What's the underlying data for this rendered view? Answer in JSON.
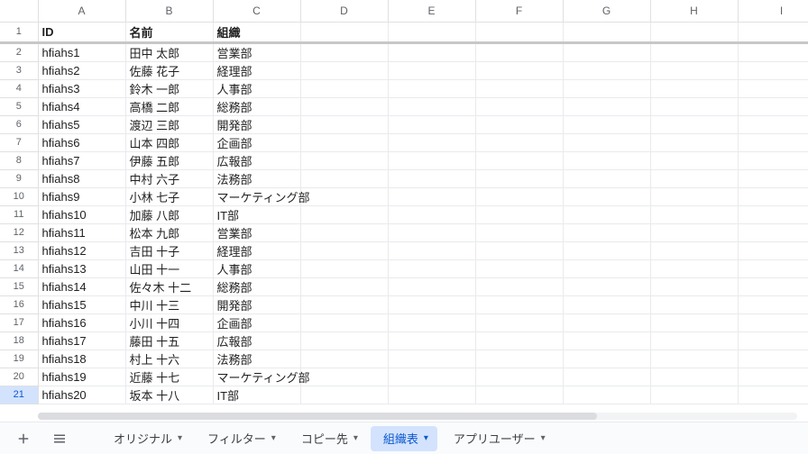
{
  "columns": [
    "A",
    "B",
    "C",
    "D",
    "E",
    "F",
    "G",
    "H",
    "I"
  ],
  "header_row": {
    "A": "ID",
    "B": "名前",
    "C": "組織"
  },
  "active_row": 21,
  "rows": [
    {
      "n": 2,
      "A": "hfiahs1",
      "B": "田中 太郎",
      "C": "営業部"
    },
    {
      "n": 3,
      "A": "hfiahs2",
      "B": "佐藤 花子",
      "C": "経理部"
    },
    {
      "n": 4,
      "A": "hfiahs3",
      "B": "鈴木 一郎",
      "C": "人事部"
    },
    {
      "n": 5,
      "A": "hfiahs4",
      "B": "高橋 二郎",
      "C": "総務部"
    },
    {
      "n": 6,
      "A": "hfiahs5",
      "B": "渡辺 三郎",
      "C": "開発部"
    },
    {
      "n": 7,
      "A": "hfiahs6",
      "B": "山本 四郎",
      "C": "企画部"
    },
    {
      "n": 8,
      "A": "hfiahs7",
      "B": "伊藤 五郎",
      "C": "広報部"
    },
    {
      "n": 9,
      "A": "hfiahs8",
      "B": "中村 六子",
      "C": "法務部"
    },
    {
      "n": 10,
      "A": "hfiahs9",
      "B": "小林 七子",
      "C": "マーケティング部"
    },
    {
      "n": 11,
      "A": "hfiahs10",
      "B": "加藤 八郎",
      "C": "IT部"
    },
    {
      "n": 12,
      "A": "hfiahs11",
      "B": "松本 九郎",
      "C": "営業部"
    },
    {
      "n": 13,
      "A": "hfiahs12",
      "B": "吉田 十子",
      "C": "経理部"
    },
    {
      "n": 14,
      "A": "hfiahs13",
      "B": "山田 十一",
      "C": "人事部"
    },
    {
      "n": 15,
      "A": "hfiahs14",
      "B": "佐々木 十二",
      "C": "総務部"
    },
    {
      "n": 16,
      "A": "hfiahs15",
      "B": "中川 十三",
      "C": "開発部"
    },
    {
      "n": 17,
      "A": "hfiahs16",
      "B": "小川 十四",
      "C": "企画部"
    },
    {
      "n": 18,
      "A": "hfiahs17",
      "B": "藤田 十五",
      "C": "広報部"
    },
    {
      "n": 19,
      "A": "hfiahs18",
      "B": "村上 十六",
      "C": "法務部"
    },
    {
      "n": 20,
      "A": "hfiahs19",
      "B": "近藤 十七",
      "C": "マーケティング部"
    },
    {
      "n": 21,
      "A": "hfiahs20",
      "B": "坂本 十八",
      "C": "IT部"
    }
  ],
  "tabs": [
    {
      "id": "original",
      "label": "オリジナル",
      "active": false
    },
    {
      "id": "filter",
      "label": "フィルター",
      "active": false
    },
    {
      "id": "copyto",
      "label": "コピー先",
      "active": false
    },
    {
      "id": "orgchart",
      "label": "組織表",
      "active": true
    },
    {
      "id": "appuser",
      "label": "アプリユーザー",
      "active": false
    }
  ]
}
